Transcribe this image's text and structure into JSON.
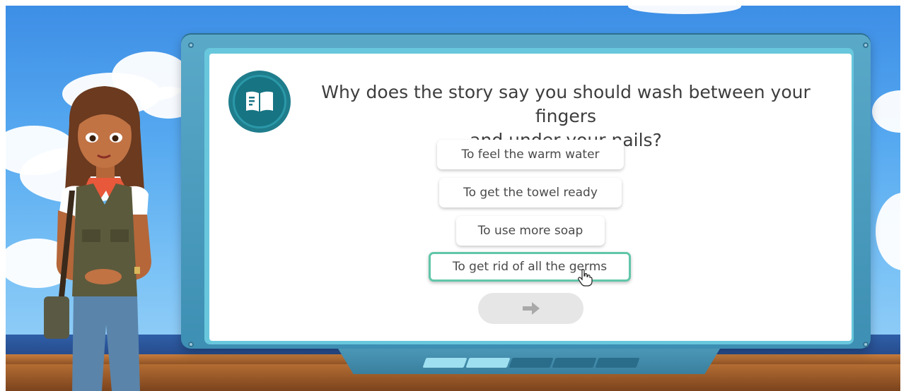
{
  "quiz": {
    "question_line1": "Why does the story say you should wash between your fingers",
    "question_line2": "and under your nails?",
    "answers": [
      {
        "label": "To feel the warm water",
        "selected": false
      },
      {
        "label": "To get the towel ready",
        "selected": false
      },
      {
        "label": "To use more soap",
        "selected": false
      },
      {
        "label": "To get rid of all the germs",
        "selected": true
      }
    ],
    "next_icon": "right-arrow-icon",
    "badge_icon": "open-book-icon"
  },
  "progress": {
    "total_steps": 5,
    "completed_steps": 2
  },
  "colors": {
    "selected_border": "#61c6a9",
    "badge": "#1f7d8c",
    "next_disabled": "#e6e6e6"
  }
}
